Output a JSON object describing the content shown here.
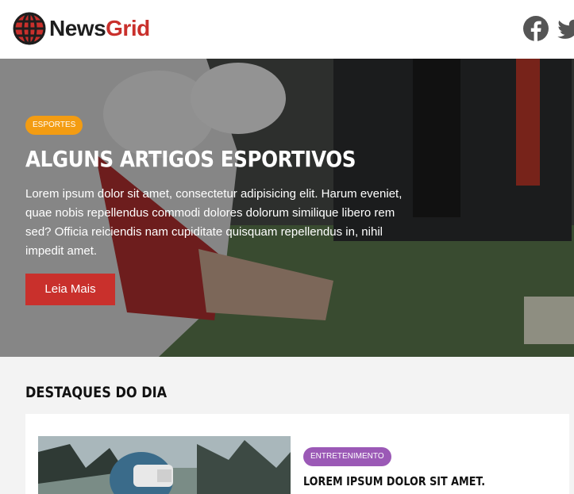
{
  "brand": {
    "name_part1": "News",
    "name_part2": "Grid",
    "logo_icon": "globe-icon",
    "accent": "#c9302c"
  },
  "social": [
    {
      "icon": "facebook-icon"
    },
    {
      "icon": "twitter-icon"
    }
  ],
  "hero": {
    "category": "ESPORTES",
    "category_color": "#f39c12",
    "title": "ALGUNS ARTIGOS ESPORTIVOS",
    "text": "Lorem ipsum dolor sit amet, consectetur adipisicing elit. Harum eveniet, quae nobis repellendus commodi dolores dolorum similique libero rem sed? Officia reiciendis nam cupiditate quisquam repellendus in, nihil impedit amet.",
    "button_label": "Leia Mais"
  },
  "highlights": {
    "title": "DESTAQUES DO DIA",
    "cards": [
      {
        "category": "ENTRETENIMENTO",
        "category_color": "#9b59b6",
        "title": "LOREM IPSUM DOLOR SIT AMET."
      }
    ]
  }
}
